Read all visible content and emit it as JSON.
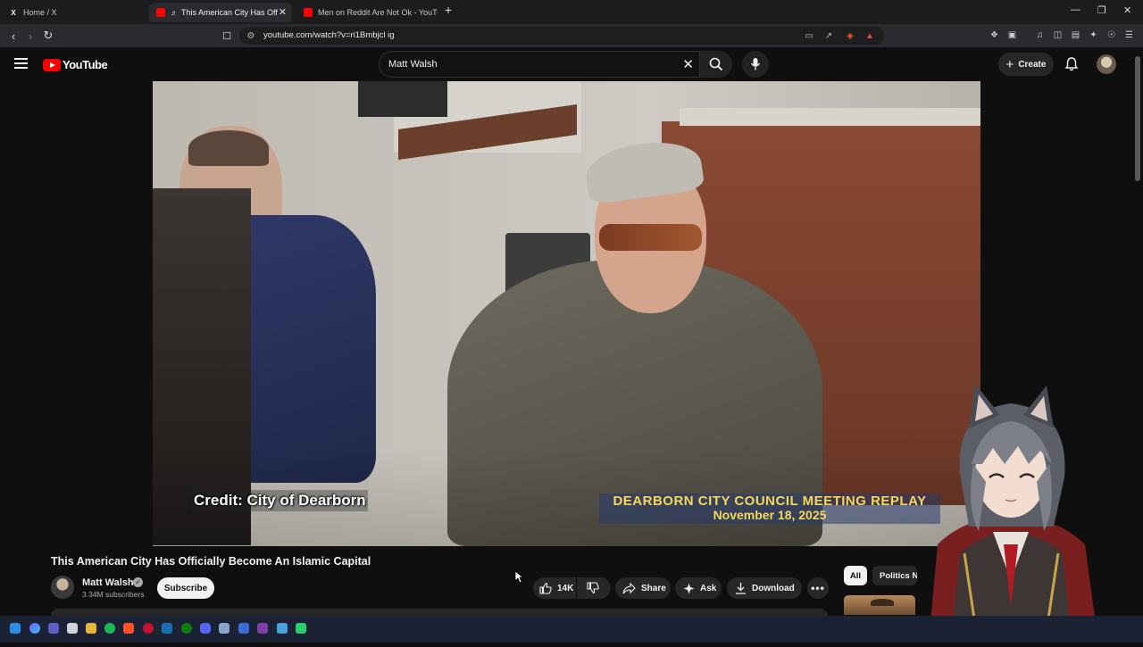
{
  "browser": {
    "tabs": [
      {
        "title": "Home / X"
      },
      {
        "title": "This American City Has Officia"
      },
      {
        "title": "Men on Reddit Are Not Ok - YouTub"
      }
    ],
    "url": "youtube.com/watch?v=ri1Bmbjcl ig"
  },
  "masthead": {
    "logo_text": "YouTube",
    "search_value": "Matt Walsh",
    "create_label": "Create"
  },
  "video": {
    "credit_text": "Credit: City of Dearborn",
    "banner_line1": "DEARBORN CITY COUNCIL MEETING REPLAY",
    "banner_line2": "November 18, 2025",
    "title": "This American City Has Officially Become An Islamic Capital"
  },
  "channel": {
    "name": "Matt Walsh",
    "subscribers": "3.34M subscribers",
    "subscribe_label": "Subscribe"
  },
  "actions": {
    "likes": "14K",
    "share_label": "Share",
    "ask_label": "Ask",
    "download_label": "Download"
  },
  "chips": {
    "all_label": "All",
    "politics_label": "Politics N"
  },
  "colors": {
    "yt_red": "#ff0000",
    "background": "#0f0f0f",
    "pill": "#272727",
    "banner_text": "#f7d65a"
  }
}
